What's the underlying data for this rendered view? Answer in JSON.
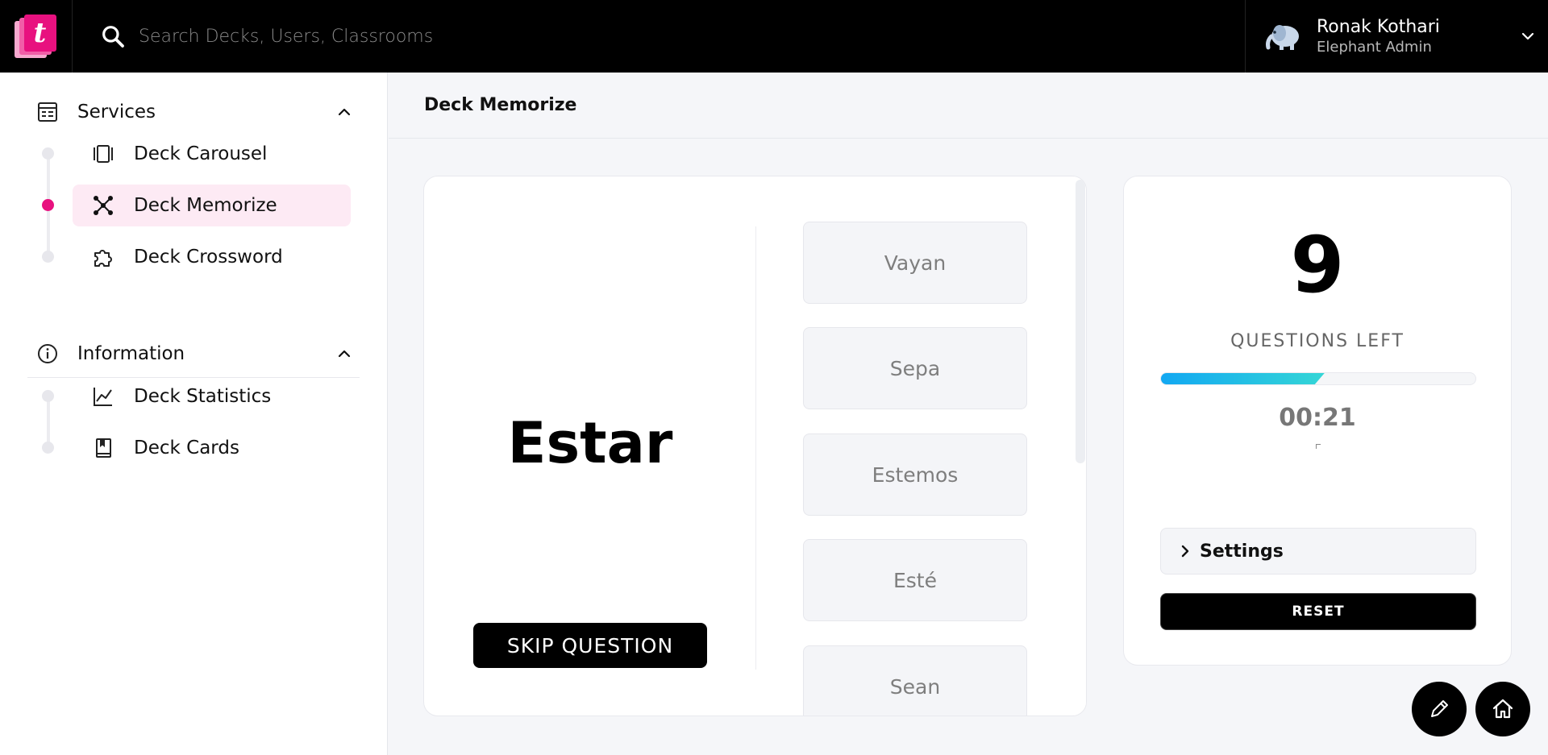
{
  "app": {
    "logo_letter": "t",
    "brand_color": "#e8117f"
  },
  "search": {
    "placeholder": "Search Decks, Users, Classrooms",
    "icon": "search-icon"
  },
  "user": {
    "name": "Ronak Kothari",
    "role": "Elephant Admin",
    "avatar_icon": "elephant-avatar-icon"
  },
  "sidebar": {
    "services": {
      "label": "Services",
      "icon": "services-icon",
      "items": [
        {
          "label": "Deck Carousel",
          "icon": "carousel-icon",
          "active": false
        },
        {
          "label": "Deck Memorize",
          "icon": "network-icon",
          "active": true
        },
        {
          "label": "Deck Crossword",
          "icon": "puzzle-icon",
          "active": false
        }
      ]
    },
    "information": {
      "label": "Information",
      "icon": "info-icon",
      "items": [
        {
          "label": "Deck Statistics",
          "icon": "chart-line-icon",
          "active": false
        },
        {
          "label": "Deck Cards",
          "icon": "book-icon",
          "active": false
        }
      ]
    }
  },
  "main": {
    "title": "Deck Memorize",
    "question": {
      "word": "Estar",
      "skip_label": "SKIP QUESTION"
    },
    "answers": [
      "Vayan",
      "Sepa",
      "Estemos",
      "Esté",
      "Sean"
    ]
  },
  "panel": {
    "questions_left": "9",
    "questions_left_label": "QUESTIONS LEFT",
    "progress_fraction": 0.52,
    "timer": "00:21",
    "settings_label": "Settings",
    "reset_label": "RESET"
  },
  "fabs": {
    "edit_icon": "pencil-icon",
    "home_icon": "home-icon"
  }
}
